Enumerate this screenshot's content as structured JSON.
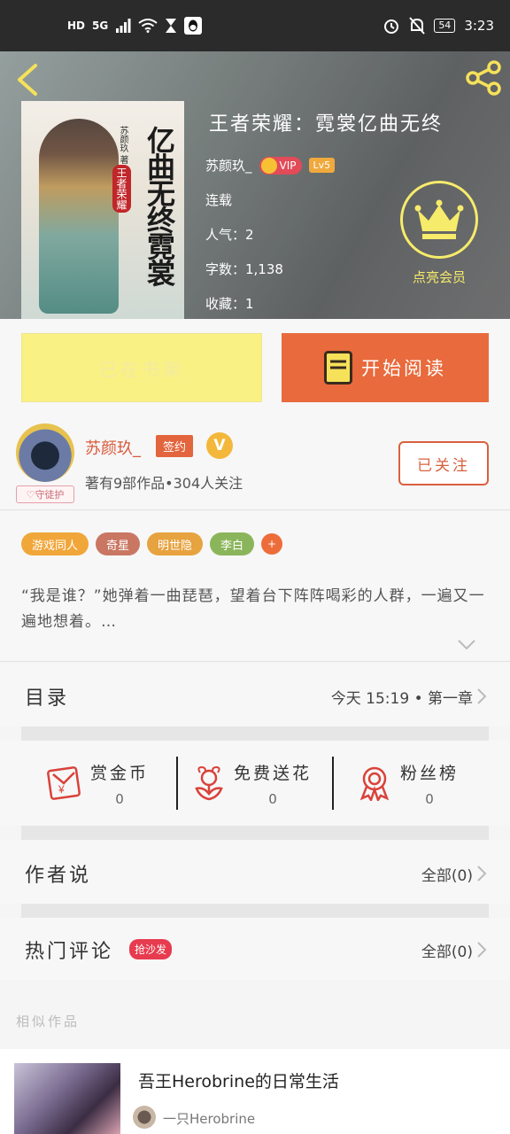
{
  "status_bar": {
    "hd": "HD",
    "net": "5G",
    "battery": "54",
    "time": "3:23"
  },
  "book": {
    "title": "王者荣耀：霓裳亿曲无终",
    "cover_title": "亿曲无终霓裳",
    "cover_author": "苏颜玖 著",
    "cover_series": "王者荣耀",
    "author": "苏颜玖_",
    "vip_label": "VIP",
    "level": "Lv5",
    "status": "连载",
    "popularity": "人气：2",
    "word_count": "字数：1,138",
    "favorites": "收藏：1"
  },
  "member": {
    "label": "点亮会员"
  },
  "actions": {
    "shelf_label": "已在书架",
    "read_label": "开始阅读"
  },
  "author_card": {
    "name": "苏颜玖_",
    "sign_badge": "签约",
    "v_badge": "V",
    "avatar_tag": "守徒护",
    "stats": "著有9部作品•304人关注",
    "follow_label": "已关注"
  },
  "tags": [
    {
      "label": "游戏同人",
      "color": "#f1a63a"
    },
    {
      "label": "奇星",
      "color": "#c97763"
    },
    {
      "label": "明世隐",
      "color": "#e7a33f"
    },
    {
      "label": "李白",
      "color": "#8bb55b"
    }
  ],
  "tag_more": "+",
  "intro": "“我是谁？”她弹着一曲琵琶，望着台下阵阵喝彩的人群，一遍又一遍地想着。…",
  "catalog": {
    "label": "目录",
    "latest": "今天 15:19 • 第一章"
  },
  "stats": [
    {
      "label": "赏金币",
      "value": "0",
      "icon": "red-envelope-icon"
    },
    {
      "label": "免费送花",
      "value": "0",
      "icon": "flower-icon"
    },
    {
      "label": "粉丝榜",
      "value": "0",
      "icon": "medal-icon"
    }
  ],
  "author_says": {
    "label": "作者说",
    "all": "全部(0)"
  },
  "hot_comments": {
    "label": "热门评论",
    "badge": "抢沙发",
    "all": "全部(0)"
  },
  "similar_label": "相似作品",
  "similar": {
    "title": "吾王Herobrine的日常生活",
    "author": "一只Herobrine"
  },
  "colors": {
    "accent": "#e96a3c",
    "shelf": "#f9f184",
    "member": "#f6eb6b"
  }
}
